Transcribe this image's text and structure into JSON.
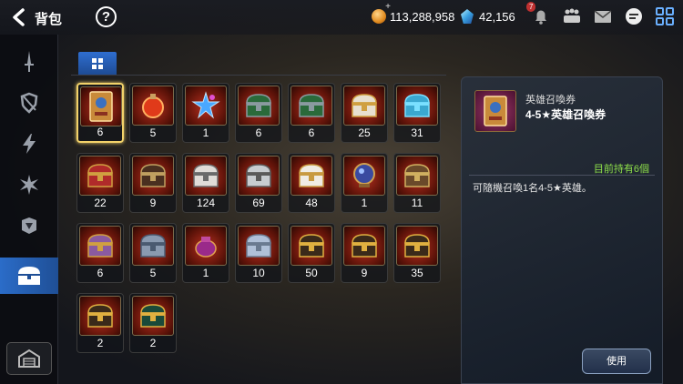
{
  "header": {
    "title": "背包",
    "gold": "113,288,958",
    "crystal": "42,156",
    "notification_count": "7"
  },
  "sidebar": {
    "items": [
      {
        "name": "equipment"
      },
      {
        "name": "armor"
      },
      {
        "name": "rune"
      },
      {
        "name": "material"
      },
      {
        "name": "fragment"
      },
      {
        "name": "chest"
      }
    ],
    "active": "chest"
  },
  "items": [
    {
      "icon": "hero-summon-ticket-icon",
      "count": "6"
    },
    {
      "icon": "red-potion-icon",
      "count": "5"
    },
    {
      "icon": "star-wand-icon",
      "count": "1"
    },
    {
      "icon": "green-chest-icon",
      "count": "6"
    },
    {
      "icon": "green-chest-icon",
      "count": "6"
    },
    {
      "icon": "gold-white-chest-icon",
      "count": "25"
    },
    {
      "icon": "blue-chest-icon",
      "count": "31"
    },
    {
      "icon": "red-chest-icon",
      "count": "22"
    },
    {
      "icon": "brown-chest-icon",
      "count": "9"
    },
    {
      "icon": "white-chest-icon",
      "count": "124"
    },
    {
      "icon": "silver-chest-icon",
      "count": "69"
    },
    {
      "icon": "white-gold-chest-icon",
      "count": "48"
    },
    {
      "icon": "orb-icon",
      "count": "1"
    },
    {
      "icon": "brown-cube-chest-icon",
      "count": "11"
    },
    {
      "icon": "purple-cube-chest-icon",
      "count": "6"
    },
    {
      "icon": "steel-cube-chest-icon",
      "count": "5"
    },
    {
      "icon": "purple-pot-icon",
      "count": "1"
    },
    {
      "icon": "silver-cube-chest-icon",
      "count": "10"
    },
    {
      "icon": "gold-treasure-chest-icon",
      "count": "50"
    },
    {
      "icon": "gold-treasure-chest-icon",
      "count": "9"
    },
    {
      "icon": "gold-treasure-chest-icon",
      "count": "35"
    },
    {
      "icon": "gold-treasure-chest-icon",
      "count": "2"
    },
    {
      "icon": "green-gold-chest-icon",
      "count": "2"
    }
  ],
  "detail": {
    "category": "英雄召喚券",
    "name": "4-5★英雄召喚券",
    "owned": "目前持有6個",
    "description": "可隨機召喚1名4-5★英雄。",
    "use_label": "使用"
  },
  "colors": {
    "accent": "#2b6cc8",
    "selected_border": "#f2d26a",
    "owned_text": "#8ee04a"
  }
}
